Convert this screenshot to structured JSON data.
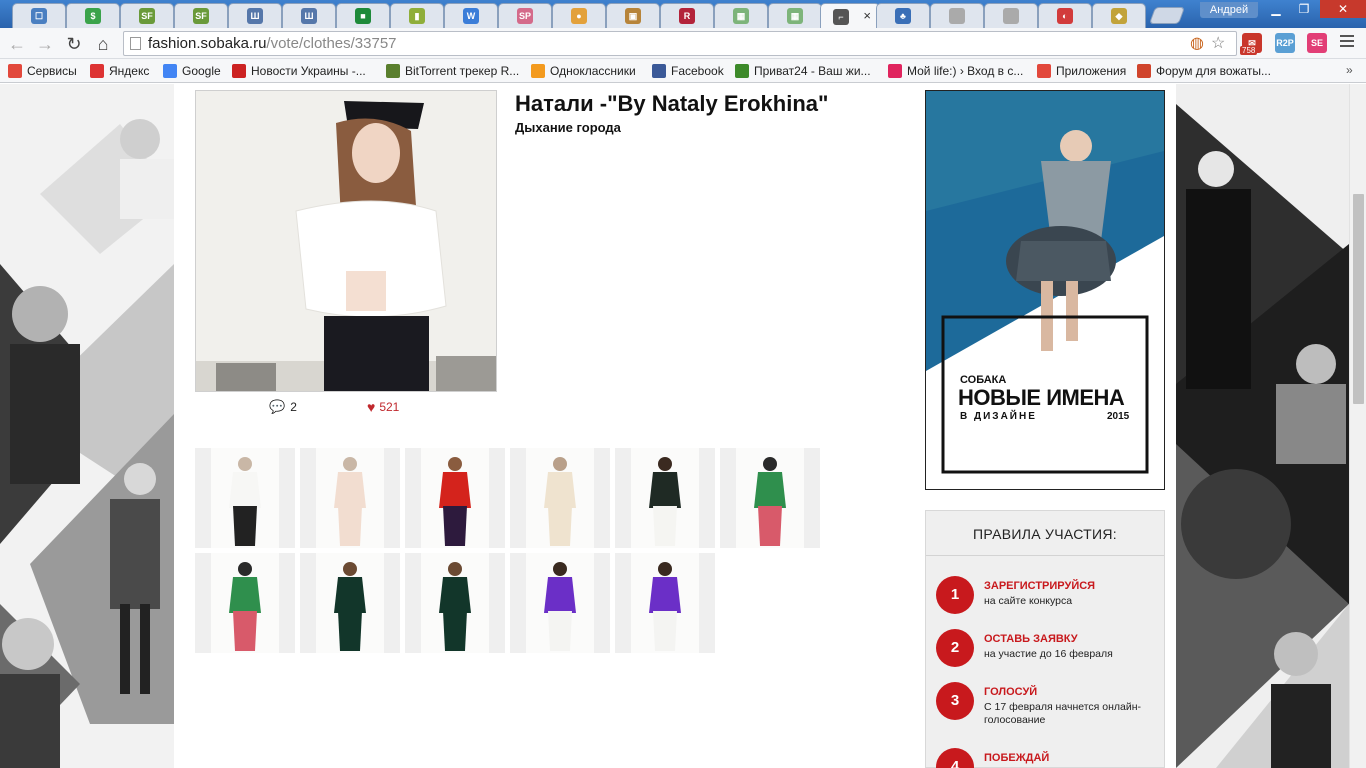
{
  "browser": {
    "user": "Андрей",
    "url_host": "fashion.sobaka.ru",
    "url_path": "/vote/clothes/33757",
    "mail_badge": "758",
    "tab_close": "×",
    "tabs": [
      {
        "icon": "chat-icon",
        "color": "#4a7fc1",
        "glyph": "☐"
      },
      {
        "icon": "dollar-icon",
        "color": "#3aa34b",
        "glyph": "$"
      },
      {
        "icon": "sf-icon",
        "color": "#6a9a3a",
        "glyph": "SF"
      },
      {
        "icon": "sf-icon",
        "color": "#6a9a3a",
        "glyph": "SF"
      },
      {
        "icon": "shi-zona-icon",
        "color": "#5577aa",
        "glyph": "Ш"
      },
      {
        "icon": "shi-zona-icon",
        "color": "#5577aa",
        "glyph": "Ш"
      },
      {
        "icon": "green-icon",
        "color": "#1e8a3a",
        "glyph": "■"
      },
      {
        "icon": "chart-icon",
        "color": "#8fae3a",
        "glyph": "▮"
      },
      {
        "icon": "w-icon",
        "color": "#3b7dd8",
        "glyph": "W"
      },
      {
        "icon": "sp-icon",
        "color": "#d46a8a",
        "glyph": "SP"
      },
      {
        "icon": "round-icon",
        "color": "#e3a13b",
        "glyph": "●"
      },
      {
        "icon": "picture-icon",
        "color": "#b7843a",
        "glyph": "▣"
      },
      {
        "icon": "r-icon",
        "color": "#b3233a",
        "glyph": "R"
      },
      {
        "icon": "map-icon",
        "color": "#7db47a",
        "glyph": "▦"
      },
      {
        "icon": "map-icon",
        "color": "#7db47a",
        "glyph": "▦"
      },
      {
        "icon": "shoe-icon",
        "color": "#555555",
        "glyph": "⌐"
      },
      {
        "icon": "bag-icon",
        "color": "#3a6fb7",
        "glyph": "♣"
      },
      {
        "icon": "doc-icon",
        "color": "#aaaaaa",
        "glyph": ""
      },
      {
        "icon": "doc-icon",
        "color": "#aaaaaa",
        "glyph": ""
      },
      {
        "icon": "cloud-icon",
        "color": "#d23b3b",
        "glyph": "◐"
      },
      {
        "icon": "disk-icon",
        "color": "#c2a33a",
        "glyph": "◆"
      }
    ],
    "bookmarks": [
      {
        "label": "Сервисы",
        "icon": "apps-icon",
        "color": "#e2483c"
      },
      {
        "label": "Яндекс",
        "icon": "yandex-icon",
        "color": "#d33"
      },
      {
        "label": "Google",
        "icon": "google-icon",
        "color": "#4285f4"
      },
      {
        "label": "Новости Украины -...",
        "icon": "ua-icon",
        "color": "#c22"
      },
      {
        "label": "BitTorrent трекер R...",
        "icon": "torrent-icon",
        "color": "#5a7f2e"
      },
      {
        "label": "Одноклассники",
        "icon": "ok-icon",
        "color": "#f39a1e"
      },
      {
        "label": "Facebook",
        "icon": "facebook-icon",
        "color": "#3b5998"
      },
      {
        "label": "Приват24 - Ваш жи...",
        "icon": "privat-icon",
        "color": "#3d8a2a"
      },
      {
        "label": "Мой life:) › Вход в с...",
        "icon": "life-icon",
        "color": "#e0245e"
      },
      {
        "label": "Приложения",
        "icon": "apps-icon",
        "color": "#e2483c"
      },
      {
        "label": "Форум для вожаты...",
        "icon": "forum-icon",
        "color": "#d0442c"
      }
    ]
  },
  "page": {
    "title": "Натали -\"By Nataly Erokhina\"",
    "subtitle": "Дыхание города",
    "comments": "2",
    "likes": "521",
    "banner": {
      "brand": "СОБАКА",
      "line1": "НОВЫЕ ИМЕНА",
      "line2": "В ДИЗАЙНЕ",
      "year": "2015"
    },
    "rules": {
      "title": "ПРАВИЛА УЧАСТИЯ:",
      "items": [
        {
          "num": "1",
          "title": "ЗАРЕГИСТРИРУЙСЯ",
          "desc": "на сайте конкурса"
        },
        {
          "num": "2",
          "title": "ОСТАВЬ ЗАЯВКУ",
          "desc": "на участие до 16 февраля"
        },
        {
          "num": "3",
          "title": "ГОЛОСУЙ",
          "desc": "С 17 февраля начнется онлайн-голосование"
        },
        {
          "num": "4",
          "title": "ПОБЕЖДАЙ",
          "desc": ""
        }
      ]
    },
    "thumbnails": [
      {
        "outfit": "white-long-coat"
      },
      {
        "outfit": "pink-gown"
      },
      {
        "outfit": "red-top-purple-trousers"
      },
      {
        "outfit": "cream-ruffle-dress"
      },
      {
        "outfit": "black-top-white-trousers"
      },
      {
        "outfit": "green-floral-coat"
      },
      {
        "outfit": "green-floral-coat"
      },
      {
        "outfit": "dark-green-coat"
      },
      {
        "outfit": "dark-green-coat"
      },
      {
        "outfit": "purple-blouse-white-skirt"
      },
      {
        "outfit": "purple-blouse-white-skirt"
      }
    ]
  }
}
